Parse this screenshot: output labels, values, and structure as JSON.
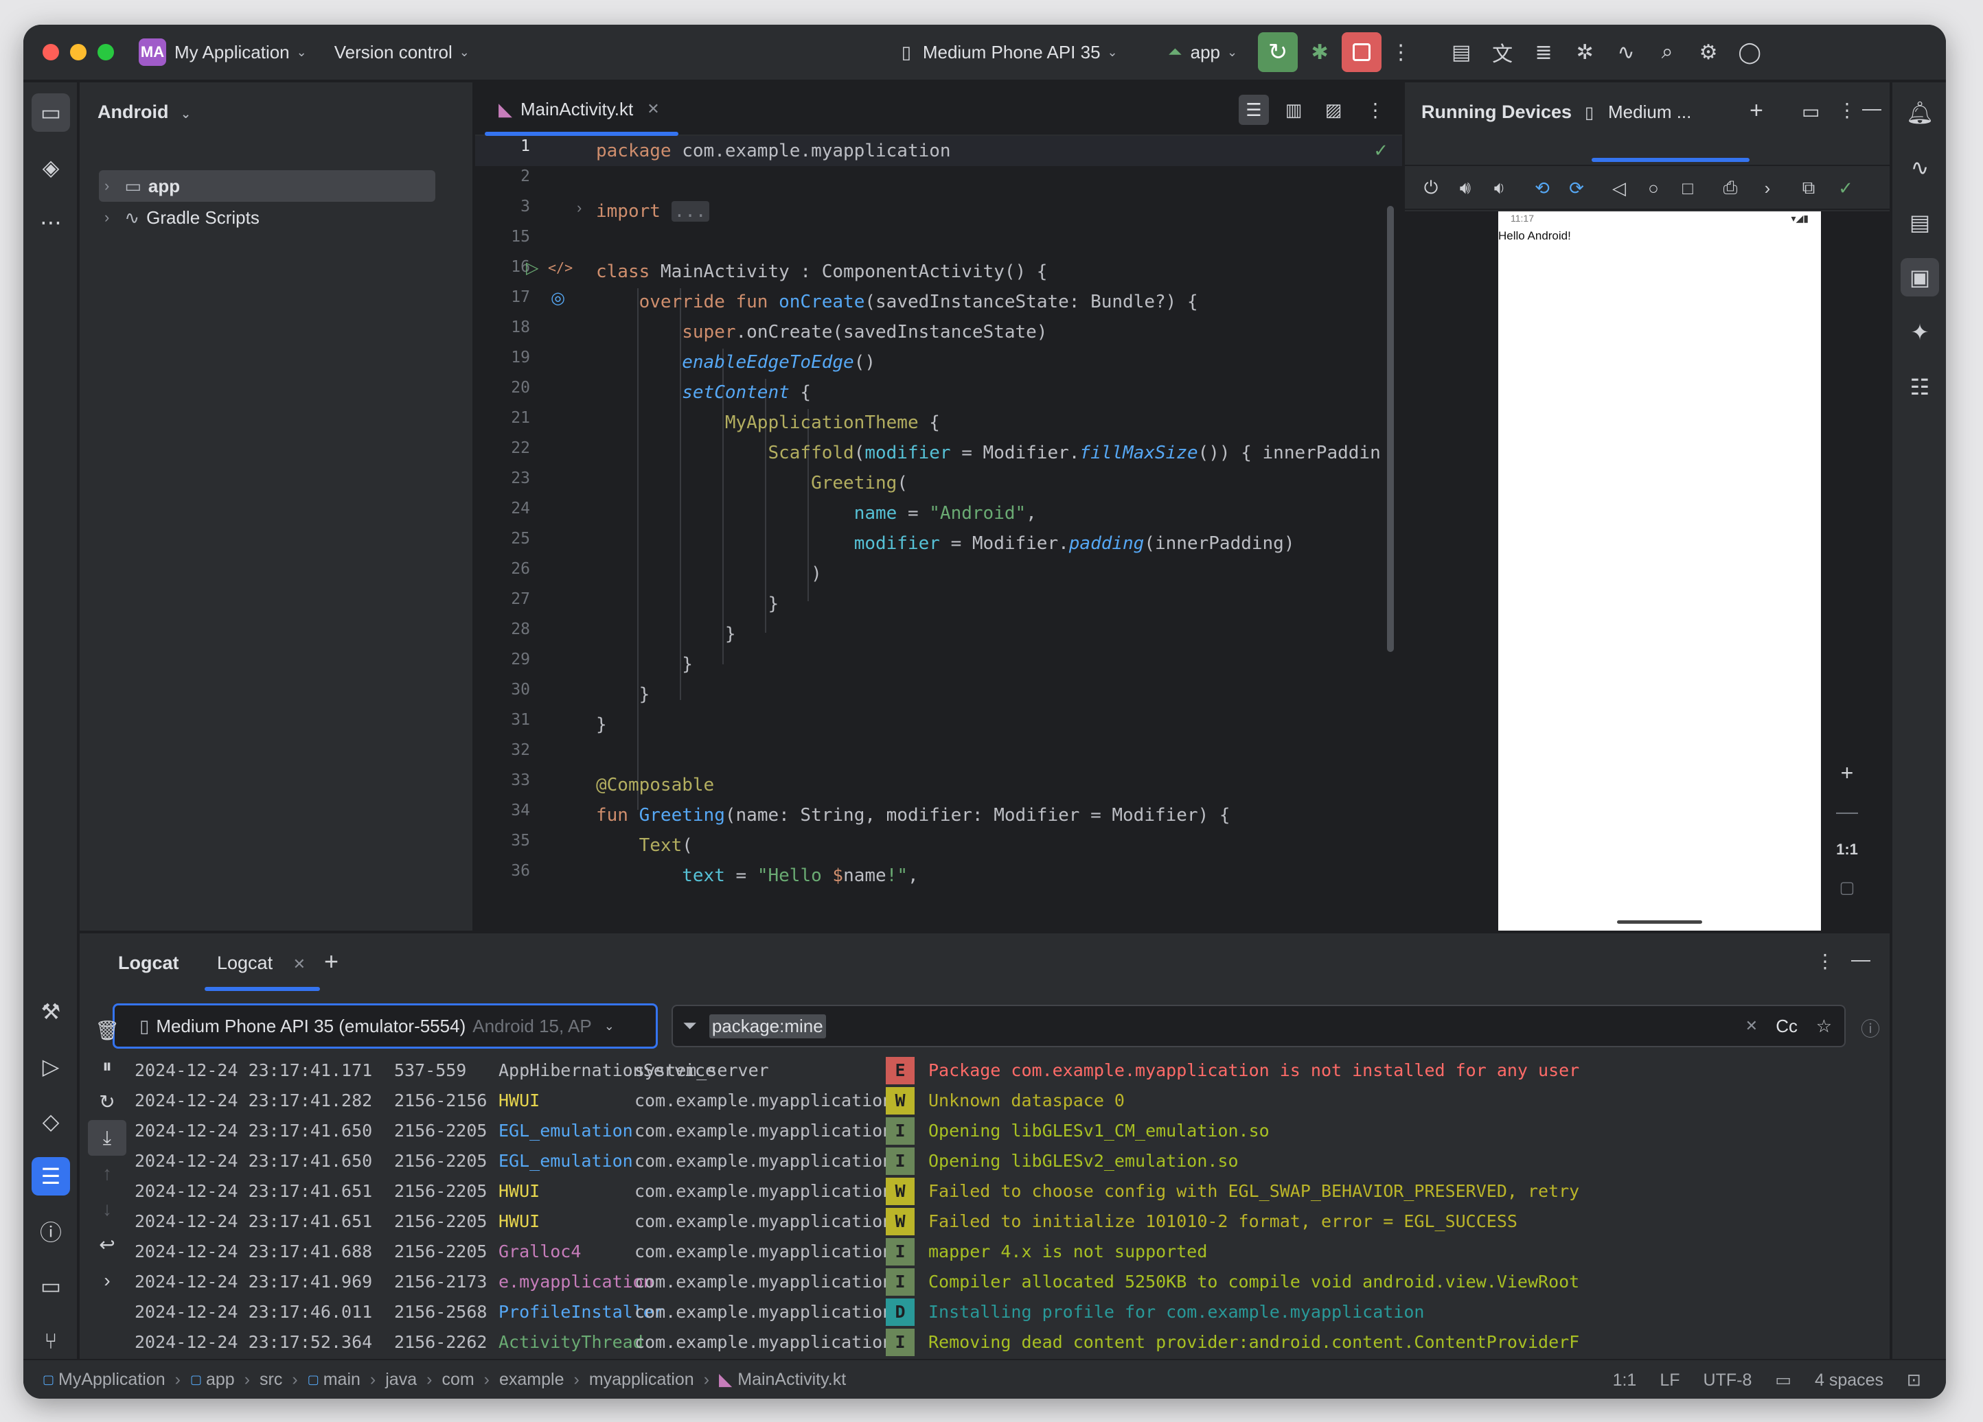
{
  "titlebar": {
    "project_badge": "MA",
    "project_name": "My Application",
    "vcs": "Version control",
    "device": "Medium Phone API 35",
    "run_config": "app"
  },
  "project_panel": {
    "title": "Android",
    "items": [
      {
        "label": "app"
      },
      {
        "label": "Gradle Scripts"
      }
    ]
  },
  "editor": {
    "tab": "MainActivity.kt",
    "line_numbers": [
      "1",
      "2",
      "3",
      "15",
      "16",
      "17",
      "18",
      "19",
      "20",
      "21",
      "22",
      "23",
      "24",
      "25",
      "26",
      "27",
      "28",
      "29",
      "30",
      "31",
      "32",
      "33",
      "34",
      "35",
      "36"
    ]
  },
  "devices": {
    "title": "Running Devices",
    "tab": "Medium ...",
    "phone_time": "11:17",
    "phone_text": "Hello Android!",
    "zoom_label": "1:1"
  },
  "logcat": {
    "title": "Logcat",
    "tab": "Logcat",
    "device": "Medium Phone API 35 (emulator-5554)",
    "device_extra": "Android 15, AP",
    "filter": "package:mine",
    "case_label": "Cc",
    "rows": [
      {
        "time": "2024-12-24 23:17:41.171",
        "pid": "537-559",
        "tag": "AppHibernationService",
        "pkg": "system_server",
        "level": "E",
        "msg": "Package com.example.myapplication is not installed for any user"
      },
      {
        "time": "2024-12-24 23:17:41.282",
        "pid": "2156-2156",
        "tag": "HWUI",
        "pkg": "com.example.myapplication",
        "level": "W",
        "msg": "Unknown dataspace 0"
      },
      {
        "time": "2024-12-24 23:17:41.650",
        "pid": "2156-2205",
        "tag": "EGL_emulation",
        "pkg": "com.example.myapplication",
        "level": "I",
        "msg": "Opening libGLESv1_CM_emulation.so"
      },
      {
        "time": "2024-12-24 23:17:41.650",
        "pid": "2156-2205",
        "tag": "EGL_emulation",
        "pkg": "com.example.myapplication",
        "level": "I",
        "msg": "Opening libGLESv2_emulation.so"
      },
      {
        "time": "2024-12-24 23:17:41.651",
        "pid": "2156-2205",
        "tag": "HWUI",
        "pkg": "com.example.myapplication",
        "level": "W",
        "msg": "Failed to choose config with EGL_SWAP_BEHAVIOR_PRESERVED, retry"
      },
      {
        "time": "2024-12-24 23:17:41.651",
        "pid": "2156-2205",
        "tag": "HWUI",
        "pkg": "com.example.myapplication",
        "level": "W",
        "msg": "Failed to initialize 101010-2 format, error = EGL_SUCCESS"
      },
      {
        "time": "2024-12-24 23:17:41.688",
        "pid": "2156-2205",
        "tag": "Gralloc4",
        "pkg": "com.example.myapplication",
        "level": "I",
        "msg": "mapper 4.x is not supported"
      },
      {
        "time": "2024-12-24 23:17:41.969",
        "pid": "2156-2173",
        "tag": "e.myapplication",
        "pkg": "com.example.myapplication",
        "level": "I",
        "msg": "Compiler allocated 5250KB to compile void android.view.ViewRoot"
      },
      {
        "time": "2024-12-24 23:17:46.011",
        "pid": "2156-2568",
        "tag": "ProfileInstaller",
        "pkg": "com.example.myapplication",
        "level": "D",
        "msg": "Installing profile for com.example.myapplication"
      },
      {
        "time": "2024-12-24 23:17:52.364",
        "pid": "2156-2262",
        "tag": "ActivityThread",
        "pkg": "com.example.myapplication",
        "level": "I",
        "msg": "Removing dead content provider:android.content.ContentProviderF"
      }
    ]
  },
  "statusbar": {
    "breadcrumb": [
      "MyApplication",
      "app",
      "src",
      "main",
      "java",
      "com",
      "example",
      "myapplication",
      "MainActivity.kt"
    ],
    "position": "1:1",
    "line_sep": "LF",
    "encoding": "UTF-8",
    "indent": "4 spaces"
  }
}
